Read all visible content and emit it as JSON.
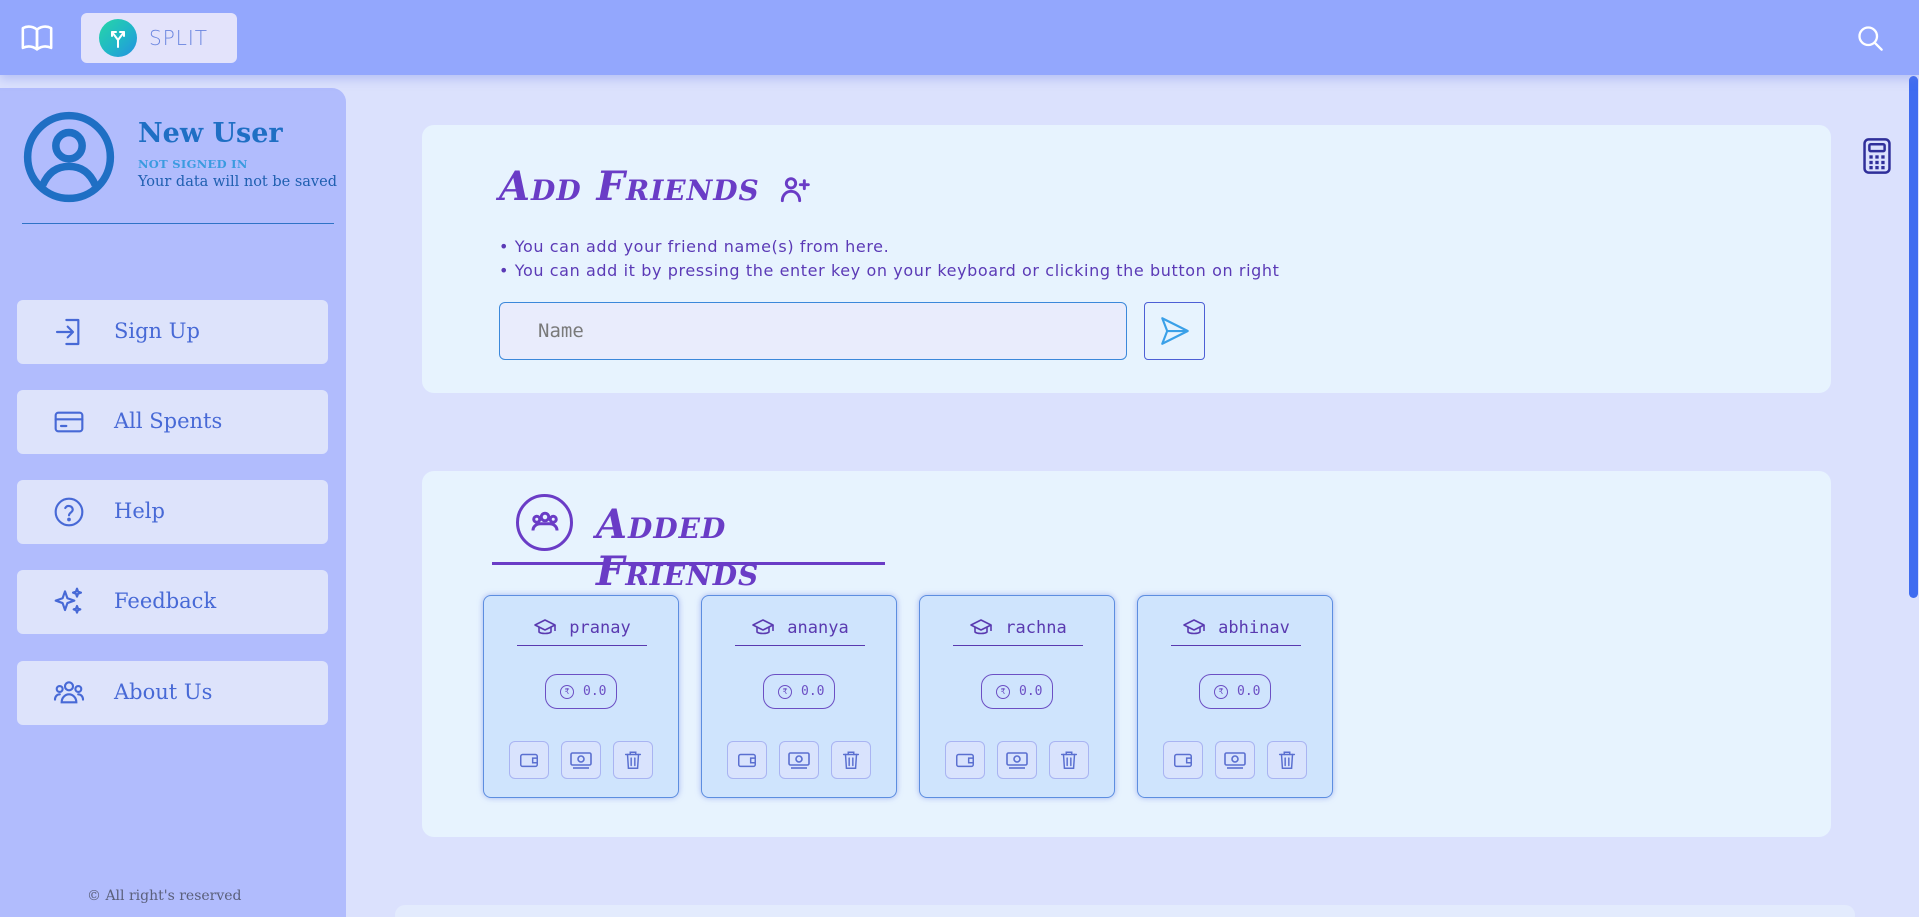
{
  "header": {
    "brand": "SPLIT"
  },
  "sidebar": {
    "user_name": "New User",
    "user_status": "NOT SIGNED IN",
    "user_note": "Your data will not be saved",
    "items": [
      {
        "label": "Sign Up",
        "icon": "sign-in-icon"
      },
      {
        "label": "All Spents",
        "icon": "credit-card-icon"
      },
      {
        "label": "Help",
        "icon": "help-icon"
      },
      {
        "label": "Feedback",
        "icon": "sparkles-icon"
      },
      {
        "label": "About Us",
        "icon": "users-icon"
      }
    ],
    "footer": "© All right's reserved"
  },
  "add_friends": {
    "title": "Add Friends",
    "bullets": [
      "• You can add your friend name(s) from here.",
      "• You can add it by pressing the enter key on your keyboard or clicking the button on right"
    ],
    "input_value": "",
    "input_placeholder": "Name"
  },
  "added_friends": {
    "title": "Added Friends",
    "friends": [
      {
        "name": "pranay",
        "amount_visible": "0.0"
      },
      {
        "name": "ananya",
        "amount_visible": "0.0"
      },
      {
        "name": "rachna",
        "amount_visible": "0.0"
      },
      {
        "name": "abhinav",
        "amount_visible": "0.0"
      }
    ]
  },
  "colors": {
    "topbar": "#93a7fd",
    "sidebar": "#b1bcfd",
    "card": "#e7f3fe",
    "accent_purple": "#6a3cc6",
    "accent_blue": "#4769d6"
  }
}
